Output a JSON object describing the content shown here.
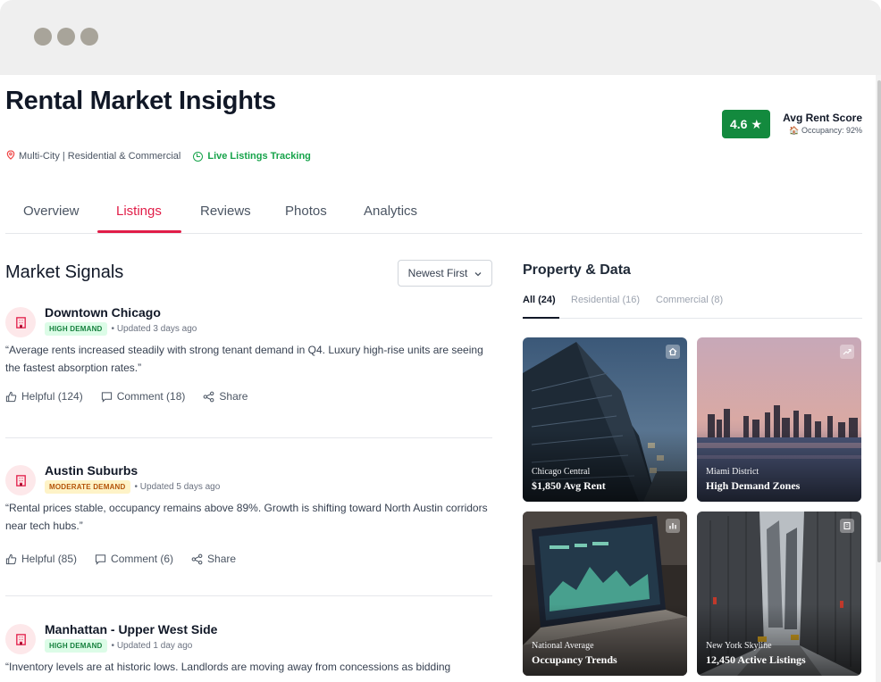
{
  "page": {
    "title": "Rental Market Insights",
    "location": "Multi-City | Residential & Commercial",
    "live_label": "Live Listings Tracking"
  },
  "score": {
    "value": "4.6",
    "label": "Avg Rent Score",
    "occupancy": "Occupancy: 92%",
    "accent": "#138a3e"
  },
  "tabs": [
    {
      "label": "Overview",
      "active": false
    },
    {
      "label": "Listings",
      "active": true
    },
    {
      "label": "Reviews",
      "active": false
    },
    {
      "label": "Photos",
      "active": false
    },
    {
      "label": "Analytics",
      "active": false
    }
  ],
  "signals": {
    "title": "Market Signals",
    "sort_label": "Newest First",
    "items": [
      {
        "name": "Downtown Chicago",
        "badge": "HIGH DEMAND",
        "badge_kind": "high",
        "updated": "• Updated 3 days ago",
        "quote": "“Average rents increased steadily with strong tenant demand in Q4. Luxury high-rise units are seeing the fastest absorption rates.”",
        "helpful": "Helpful (124)",
        "comment": "Comment (18)",
        "share": "Share"
      },
      {
        "name": "Austin Suburbs",
        "badge": "MODERATE DEMAND",
        "badge_kind": "moderate",
        "updated": "• Updated 5 days ago",
        "quote": "“Rental prices stable, occupancy remains above 89%. Growth is shifting toward North Austin corridors near tech hubs.”",
        "helpful": "Helpful (85)",
        "comment": "Comment (6)",
        "share": "Share"
      },
      {
        "name": "Manhattan - Upper West Side",
        "badge": "HIGH DEMAND",
        "badge_kind": "high",
        "updated": "• Updated 1 day ago",
        "quote": "“Inventory levels are at historic lows. Landlords are moving away from concessions as bidding"
      }
    ]
  },
  "property": {
    "title": "Property & Data",
    "subtabs": [
      {
        "label": "All (24)",
        "active": true
      },
      {
        "label": "Residential (16)",
        "active": false
      },
      {
        "label": "Commercial (8)",
        "active": false
      }
    ],
    "cards": [
      {
        "caption": "Chicago Central",
        "headline": "$1,850 Avg Rent",
        "icon": "home-icon"
      },
      {
        "caption": "Miami District",
        "headline": "High Demand Zones",
        "icon": "trend-up-icon"
      },
      {
        "caption": "National Average",
        "headline": "Occupancy Trends",
        "icon": "bar-chart-icon"
      },
      {
        "caption": "New York Skyline",
        "headline": "12,450 Active Listings",
        "icon": "building-icon"
      }
    ]
  }
}
